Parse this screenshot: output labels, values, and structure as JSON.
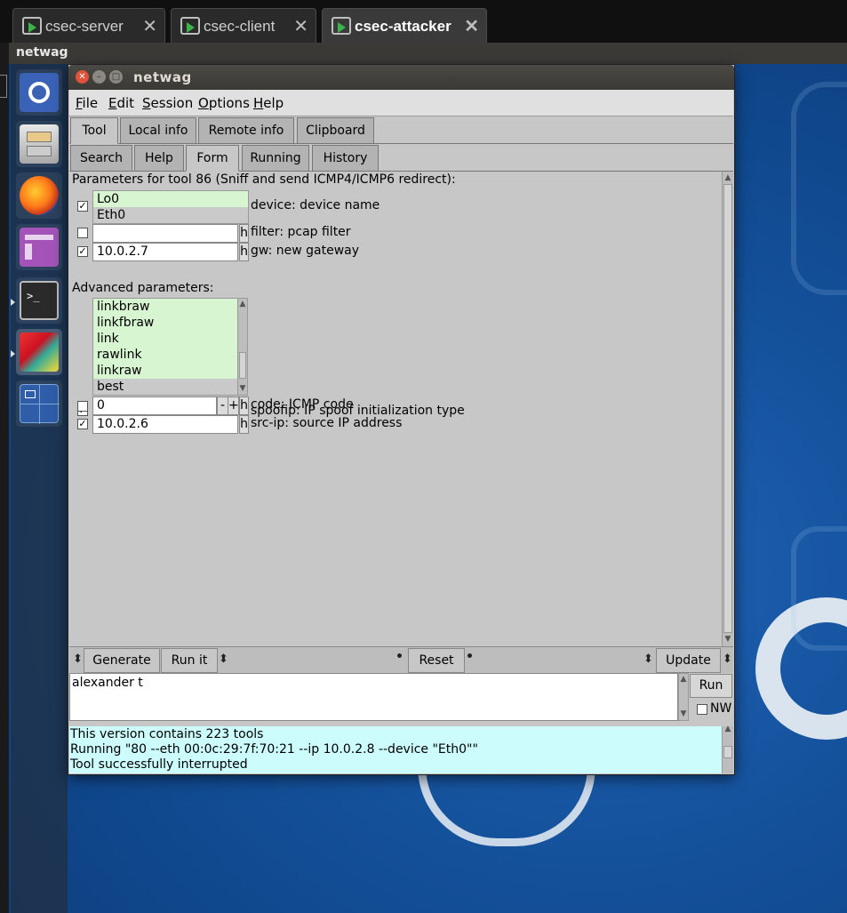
{
  "host": {
    "tabs": [
      {
        "label": "csec-server",
        "active": false
      },
      {
        "label": "csec-client",
        "active": false
      },
      {
        "label": "csec-attacker",
        "active": true
      }
    ],
    "close_glyph": "✕",
    "guest_title": "netwag"
  },
  "launcher": {
    "items": [
      "ubuntu-icon",
      "file-cabinet-icon",
      "firefox-icon",
      "window-manager-icon",
      "terminal-icon",
      "netwag-app-icon",
      "workspace-switcher-icon"
    ]
  },
  "window": {
    "title": "netwag",
    "menu": [
      "File",
      "Edit",
      "Session",
      "Options",
      "Help"
    ],
    "main_tabs": [
      "Tool",
      "Local info",
      "Remote info",
      "Clipboard"
    ],
    "sub_tabs": [
      "Search",
      "Help",
      "Form",
      "Running",
      "History"
    ],
    "selected_main_tab": "Tool",
    "selected_sub_tab": "Form"
  },
  "form": {
    "header": "Parameters for tool 86 (Sniff and send ICMP4/ICMP6 redirect):",
    "device": {
      "options": [
        "Lo0",
        "Eth0"
      ],
      "selected": "Eth0",
      "label": "device: device name",
      "checked": true
    },
    "filter": {
      "value": "",
      "h": "h",
      "label": "filter: pcap filter",
      "checked": false
    },
    "gw": {
      "value": "10.0.2.7",
      "h": "h",
      "label": "gw: new gateway",
      "checked": true
    },
    "advanced_header": "Advanced parameters:",
    "spoofip": {
      "options": [
        "linkbraw",
        "linkfbraw",
        "link",
        "rawlink",
        "linkraw",
        "best"
      ],
      "selected": "best",
      "label": "spoofip: IP spoof initialization type",
      "checked": true
    },
    "code": {
      "value": "0",
      "minus": "-",
      "plus": "+",
      "h": "h",
      "label": "code: ICMP code",
      "checked": false
    },
    "src_ip": {
      "value": "10.0.2.6",
      "h": "h",
      "label": "src-ip: source IP address",
      "checked": true
    }
  },
  "toolbar": {
    "generate": "Generate",
    "run_it": "Run it",
    "reset": "Reset",
    "update": "Update"
  },
  "command": {
    "text": "alexander t",
    "run": "Run",
    "nw": "NW"
  },
  "status": {
    "lines": [
      "This version contains 223 tools",
      "Running \"80 --eth  00:0c:29:7f:70:21 --ip 10.0.2.8 --device \"Eth0\"\"",
      "Tool successfully interrupted"
    ]
  },
  "colors": {
    "list_bg": "#d6f5d0",
    "status_bg": "#cdfcfc",
    "window_bg": "#c7c7c7"
  }
}
